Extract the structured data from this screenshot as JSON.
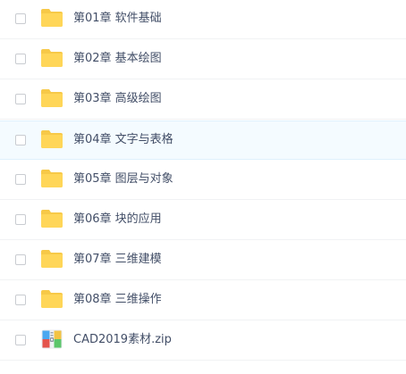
{
  "files": [
    {
      "name": "第01章 软件基础",
      "type": "folder",
      "icon": "folder-icon"
    },
    {
      "name": "第02章 基本绘图",
      "type": "folder",
      "icon": "folder-icon"
    },
    {
      "name": "第03章 高级绘图",
      "type": "folder",
      "icon": "folder-icon"
    },
    {
      "name": "第04章 文字与表格",
      "type": "folder",
      "icon": "folder-icon",
      "hovered": true
    },
    {
      "name": "第05章 图层与对象",
      "type": "folder",
      "icon": "folder-icon"
    },
    {
      "name": "第06章 块的应用",
      "type": "folder",
      "icon": "folder-icon"
    },
    {
      "name": "第07章 三维建模",
      "type": "folder",
      "icon": "folder-icon"
    },
    {
      "name": "第08章 三维操作",
      "type": "folder",
      "icon": "folder-icon"
    },
    {
      "name": "CAD2019素材.zip",
      "type": "zip",
      "icon": "zip-archive-icon"
    }
  ],
  "colors": {
    "folder": "#ffd658",
    "folder_tab": "#f7c948",
    "text": "#424e67",
    "hover_background": "#f4fbff"
  }
}
